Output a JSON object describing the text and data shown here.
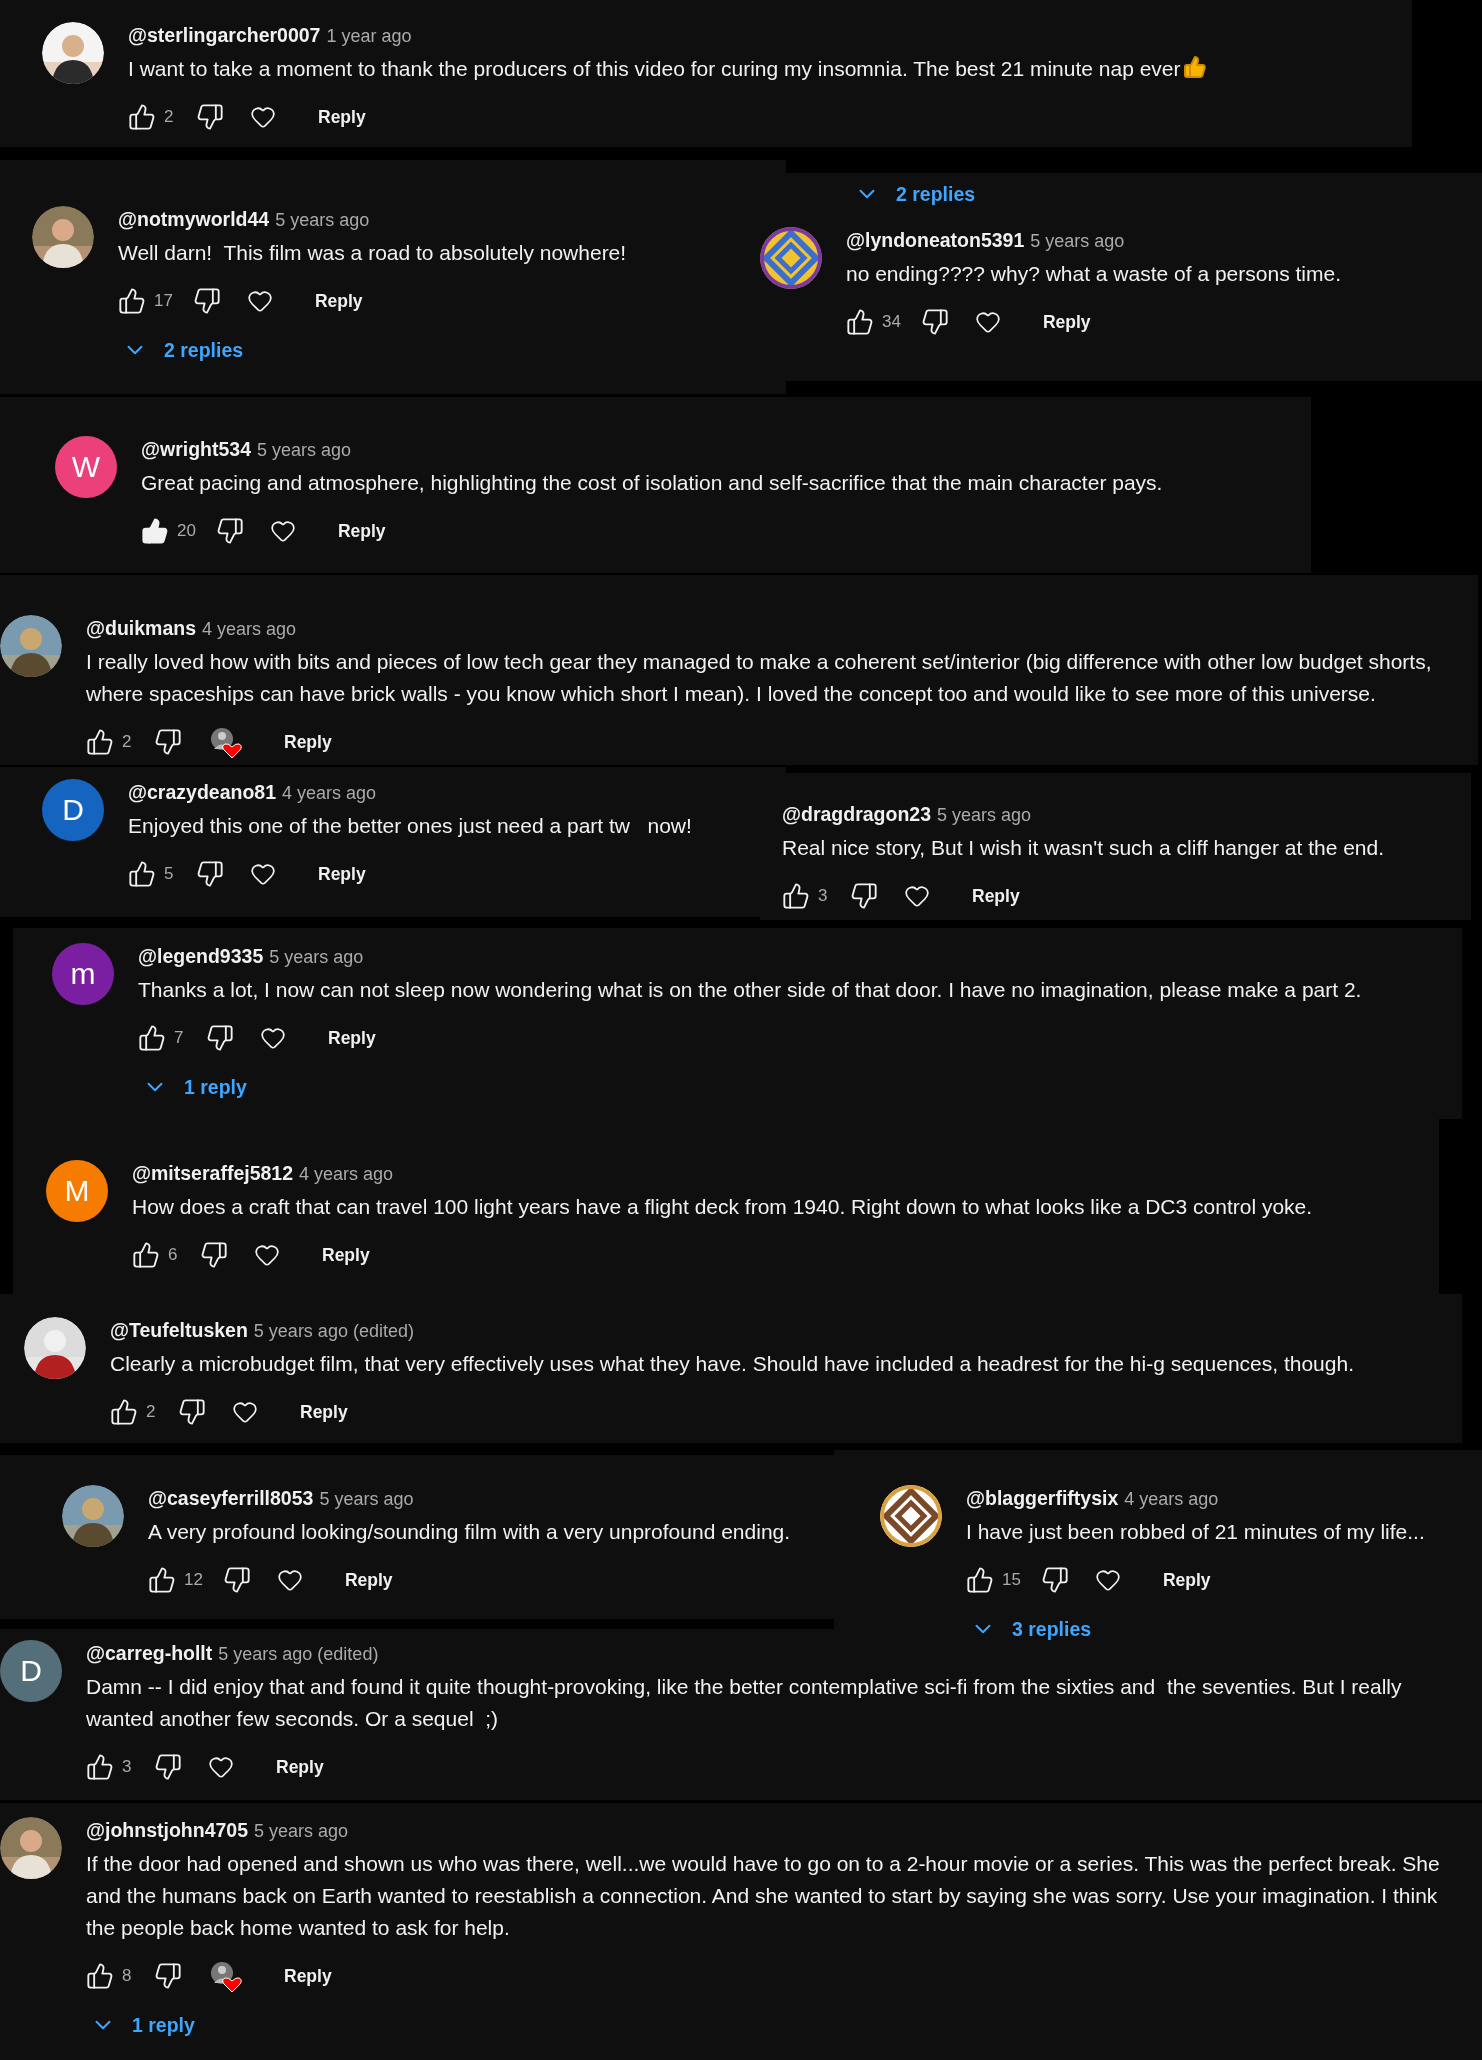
{
  "comments": [
    {
      "author": "@sterlingarcher0007",
      "time": "1 year ago",
      "text": "I want to take a moment to thank the producers of this video for curing my insomnia. The best 21 minute nap ever",
      "ends_with_emoji": true,
      "likes": "2",
      "liked": false,
      "creator_heart": false,
      "reply": "Reply"
    },
    {
      "author": "@notmyworld44",
      "time": "5 years ago",
      "text": "Well darn!  This film was a road to absolutely nowhere!",
      "likes": "17",
      "liked": false,
      "creator_heart": false,
      "reply": "Reply",
      "replies": {
        "label": "2 replies"
      }
    },
    {
      "author": "@lyndoneaton5391",
      "time": "5 years ago",
      "text": "no ending???? why? what a waste of a persons time.",
      "likes": "34",
      "liked": false,
      "creator_heart": false,
      "reply": "Reply",
      "replies_above": {
        "label": "2 replies"
      }
    },
    {
      "author": "@wright534",
      "time": "5 years ago",
      "text": "Great pacing and atmosphere, highlighting the cost of isolation and self-sacrifice that the main character pays.",
      "avatar": {
        "kind": "letter",
        "letter": "W",
        "color": "#ec407a"
      },
      "likes": "20",
      "liked": true,
      "creator_heart": false,
      "reply": "Reply"
    },
    {
      "author": "@duikmans",
      "time": "4 years ago",
      "text": "I really loved how with bits and pieces of low tech gear they managed to make a coherent set/interior (big difference with other low budget shorts, where spaceships can have brick walls - you know which short I mean). I loved the concept too and would like to see more of this universe.",
      "likes": "2",
      "liked": false,
      "creator_heart": true,
      "reply": "Reply"
    },
    {
      "author": "@crazydeano81",
      "time": "4 years ago",
      "text": "Enjoyed this one of the better ones just need a part tw   now!",
      "avatar": {
        "kind": "letter",
        "letter": "D",
        "color": "#1565c0"
      },
      "likes": "5",
      "liked": false,
      "creator_heart": false,
      "reply": "Reply"
    },
    {
      "author": "@dragdragon23",
      "time": "5 years ago",
      "text": "Real nice story, But I wish it wasn't such a cliff hanger at the end.",
      "likes": "3",
      "liked": false,
      "creator_heart": false,
      "reply": "Reply"
    },
    {
      "author": "@legend9335",
      "time": "5 years ago",
      "text": "Thanks a lot, I now can not sleep now wondering what is on the other side of that door. I have no imagination, please make a part 2.",
      "avatar": {
        "kind": "letter",
        "letter": "m",
        "color": "#7b1fa2"
      },
      "likes": "7",
      "liked": false,
      "creator_heart": false,
      "reply": "Reply",
      "replies": {
        "label": "1 reply"
      }
    },
    {
      "author": "@mitseraffej5812",
      "time": "4 years ago",
      "text": "How does a craft that can travel 100 light years have a flight deck from 1940. Right down to what looks like a DC3 control yoke.",
      "avatar": {
        "kind": "letter",
        "letter": "M",
        "color": "#f57c00"
      },
      "likes": "6",
      "liked": false,
      "creator_heart": false,
      "reply": "Reply"
    },
    {
      "author": "@Teufeltusken",
      "time": "5 years ago (edited)",
      "text": "Clearly a microbudget film, that very effectively uses what they have. Should have included a headrest for the hi-g sequences, though.",
      "likes": "2",
      "liked": false,
      "creator_heart": false,
      "reply": "Reply"
    },
    {
      "author": "@caseyferrill8053",
      "time": "5 years ago",
      "text": "A very profound looking/sounding film with a very unprofound ending.",
      "likes": "12",
      "liked": false,
      "creator_heart": false,
      "reply": "Reply"
    },
    {
      "author": "@blaggerfiftysix",
      "time": "4 years ago",
      "text": "I have just been robbed of 21 minutes of my life...",
      "likes": "15",
      "liked": false,
      "creator_heart": false,
      "reply": "Reply",
      "replies": {
        "label": "3 replies"
      }
    },
    {
      "author": "@carreg-hollt",
      "time": "5 years ago (edited)",
      "text": "Damn -- I did enjoy that and found it quite thought-provoking, like the better contemplative sci-fi from the sixties and  the seventies. But I really wanted another few seconds. Or a sequel  ;)",
      "avatar": {
        "kind": "letter",
        "letter": "D",
        "color": "#546e7a"
      },
      "likes": "3",
      "liked": false,
      "creator_heart": false,
      "reply": "Reply"
    },
    {
      "author": "@johnstjohn4705",
      "time": "5 years ago",
      "text": "If the door had opened and shown us who was there, well...we would have to go on to a 2-hour movie or a series. This was the perfect break. She and the humans back on Earth wanted to reestablish a connection. And she wanted to start by saying she was sorry. Use your imagination. I think the people back home wanted to ask for help.",
      "likes": "8",
      "liked": false,
      "creator_heart": true,
      "reply": "Reply",
      "replies": {
        "label": "1 reply"
      }
    }
  ]
}
